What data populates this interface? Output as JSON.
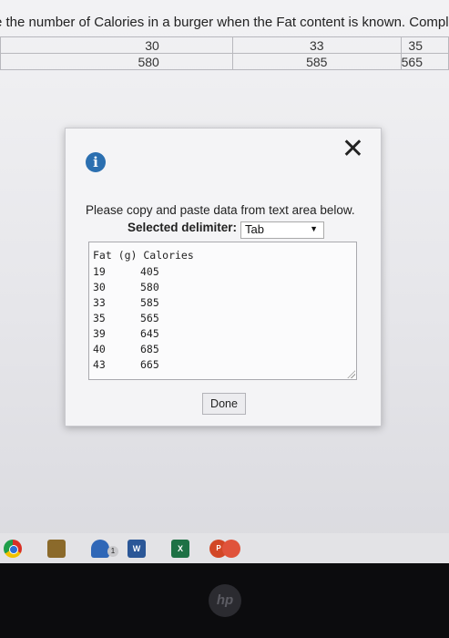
{
  "question": {
    "text": "e the number of Calories in a burger when the Fat content is known. Complete p"
  },
  "table": {
    "rows": [
      [
        "30",
        "33",
        "35"
      ],
      [
        "580",
        "585",
        "565"
      ]
    ]
  },
  "dialog": {
    "close_label": "✕",
    "info_label": "i",
    "instruction": "Please copy and paste data from text area below.",
    "delimiter_label": "Selected delimiter:",
    "delimiter_value": "Tab",
    "textarea": {
      "header": "Fat (g) Calories",
      "rows": [
        {
          "fat": "19",
          "calories": "405"
        },
        {
          "fat": "30",
          "calories": "580"
        },
        {
          "fat": "33",
          "calories": "585"
        },
        {
          "fat": "35",
          "calories": "565"
        },
        {
          "fat": "39",
          "calories": "645"
        },
        {
          "fat": "40",
          "calories": "685"
        },
        {
          "fat": "43",
          "calories": "665"
        }
      ]
    },
    "done_label": "Done"
  },
  "taskbar": {
    "word_label": "W",
    "excel_label": "X",
    "ppt_label": "P",
    "store_badge": "1",
    "icons": [
      "chrome-icon",
      "file-explorer-icon",
      "store-icon",
      "word-icon",
      "excel-icon",
      "powerpoint-icon"
    ]
  },
  "bezel": {
    "logo_text": "hp"
  }
}
